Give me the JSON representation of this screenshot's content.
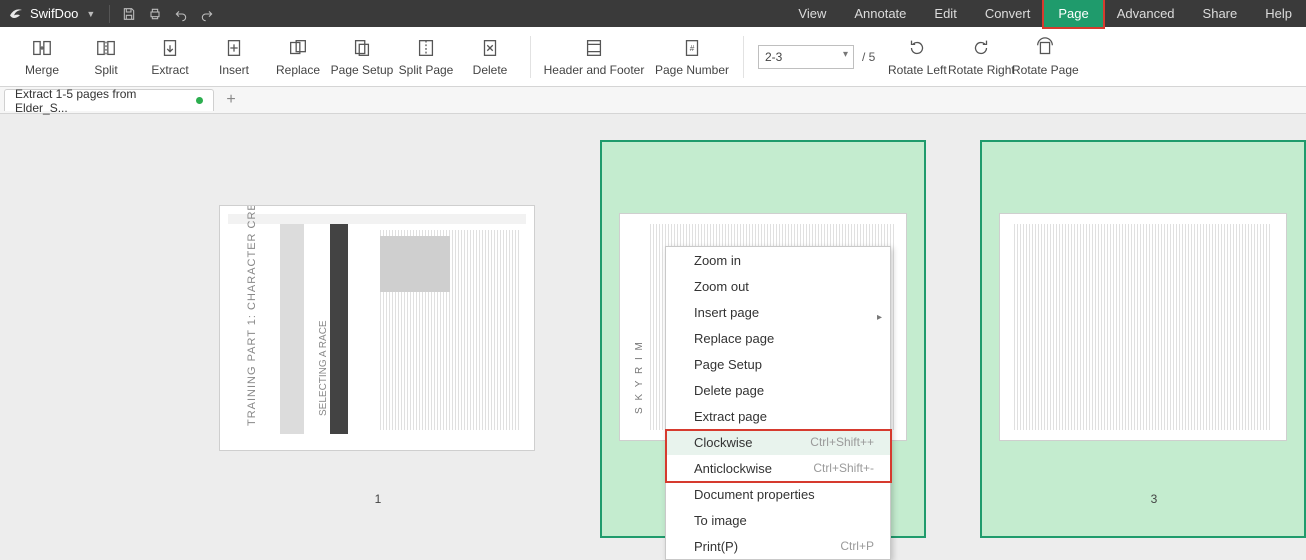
{
  "app": {
    "name": "SwifDoo"
  },
  "menubar": {
    "items": [
      "View",
      "Annotate",
      "Edit",
      "Convert",
      "Page",
      "Advanced",
      "Share",
      "Help"
    ],
    "active_index": 4
  },
  "ribbon": {
    "merge": "Merge",
    "split": "Split",
    "extract": "Extract",
    "insert": "Insert",
    "replace": "Replace",
    "page_setup": "Page Setup",
    "split_page": "Split Page",
    "delete": "Delete",
    "header_footer": "Header and Footer",
    "page_number": "Page Number",
    "range_value": "2-3",
    "range_total": "/ 5",
    "rotate_left": "Rotate Left",
    "rotate_right": "Rotate Right",
    "rotate_page": "Rotate Page"
  },
  "tabs": {
    "doc_title": "Extract 1-5 pages from Elder_S...",
    "modified": true
  },
  "thumbnails": {
    "captions": [
      "1",
      "3"
    ],
    "selected": [
      1,
      2
    ]
  },
  "context_menu": {
    "items": [
      {
        "label": "Zoom in"
      },
      {
        "label": "Zoom out"
      },
      {
        "label": "Insert page",
        "submenu": true
      },
      {
        "label": "Replace page"
      },
      {
        "label": "Page Setup"
      },
      {
        "label": "Delete page"
      },
      {
        "label": "Extract page"
      },
      {
        "label": "Clockwise",
        "shortcut": "Ctrl+Shift++",
        "hover": true
      },
      {
        "label": "Anticlockwise",
        "shortcut": "Ctrl+Shift+-"
      },
      {
        "label": "Document properties"
      },
      {
        "label": "To image"
      },
      {
        "label": "Print(P)",
        "shortcut": "Ctrl+P"
      }
    ]
  }
}
